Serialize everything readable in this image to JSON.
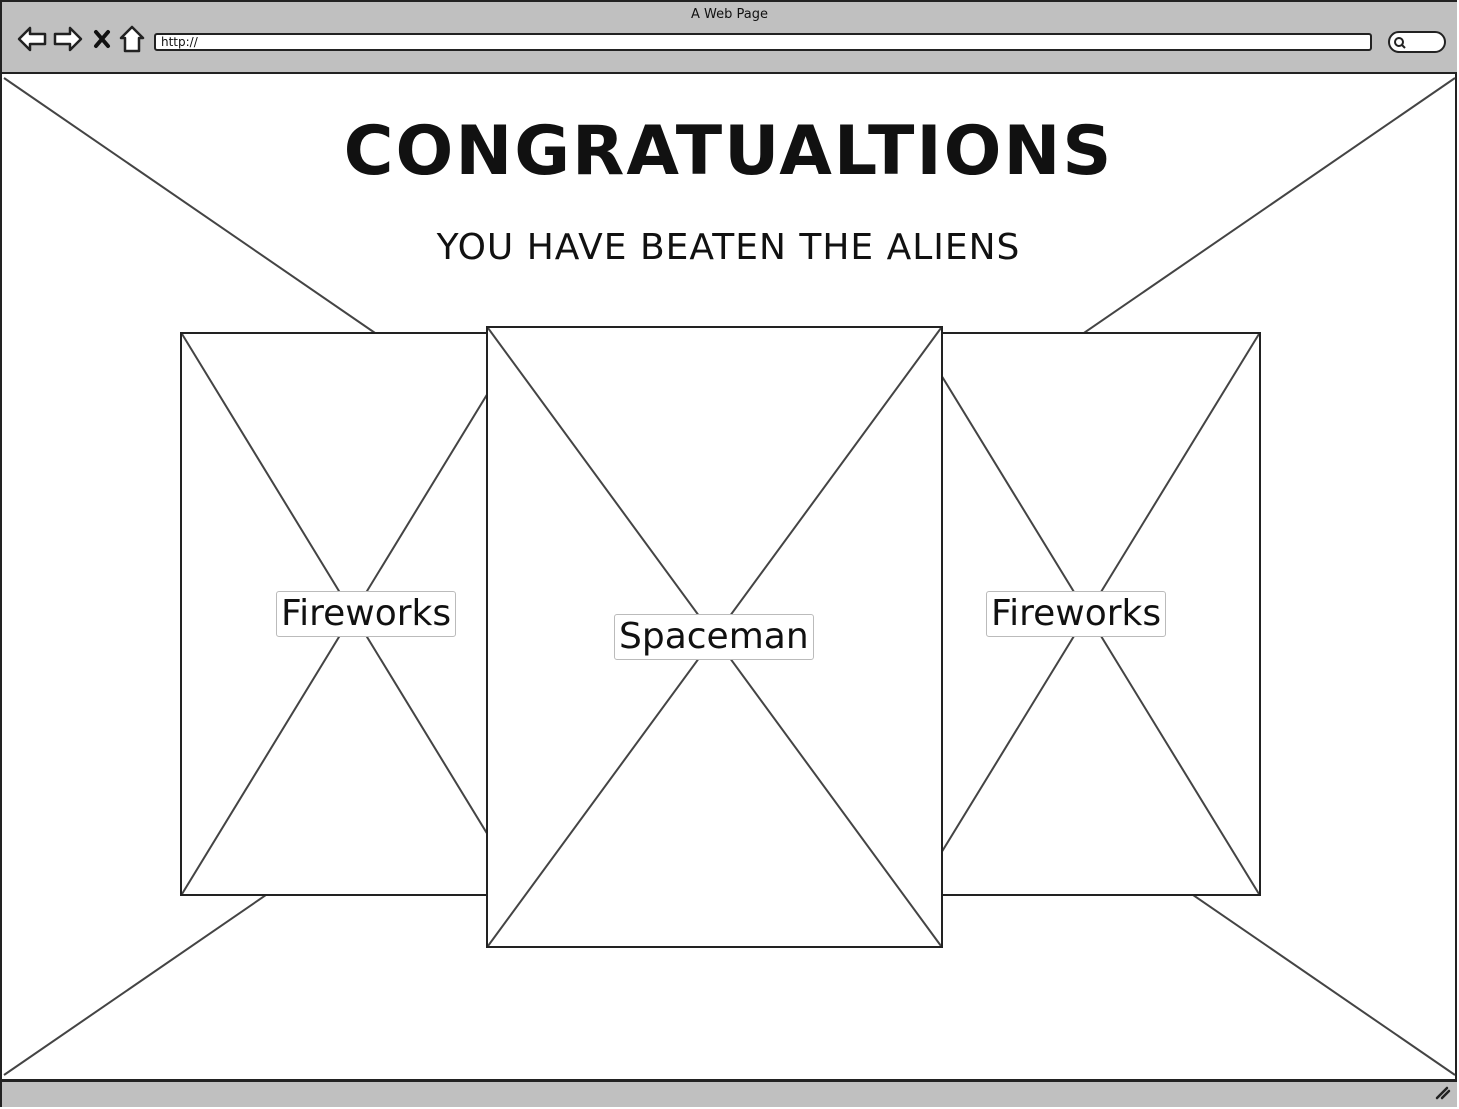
{
  "browser": {
    "title": "A Web Page",
    "url": "http://",
    "icons": [
      "back-arrow-icon",
      "forward-arrow-icon",
      "close-icon",
      "home-icon",
      "search-icon",
      "resize-grip-icon"
    ]
  },
  "page": {
    "heading": "CONGRATUALTIONS",
    "subheading": "YOU HAVE BEATEN THE ALIENS"
  },
  "images": [
    {
      "label": "Fireworks"
    },
    {
      "label": "Spaceman"
    },
    {
      "label": "Fireworks"
    }
  ]
}
